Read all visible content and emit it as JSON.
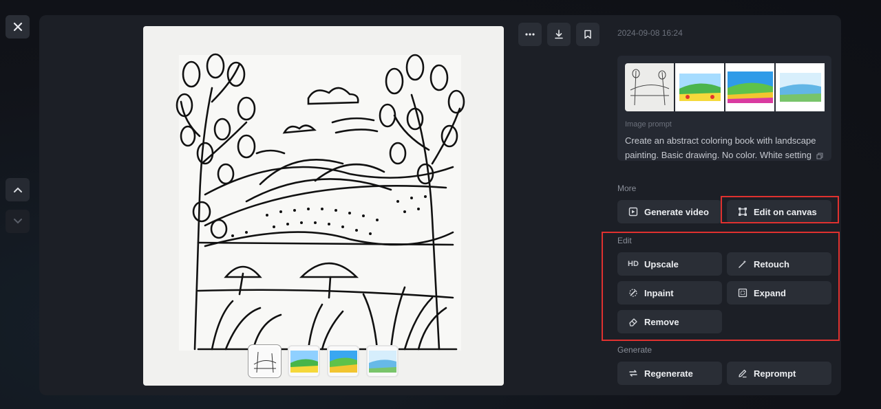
{
  "timestamp": "2024-09-08 16:24",
  "prompt": {
    "label": "Image prompt",
    "text": "Create an abstract coloring book with landscape painting. Basic drawing. No color. White setting"
  },
  "sections": {
    "more": {
      "label": "More",
      "items": [
        {
          "label": "Generate video",
          "icon": "video-plus-icon"
        },
        {
          "label": "Edit on canvas",
          "icon": "canvas-frame-icon"
        }
      ]
    },
    "edit": {
      "label": "Edit",
      "items": [
        {
          "label": "Upscale",
          "icon": "hd-icon",
          "glyph": "HD"
        },
        {
          "label": "Retouch",
          "icon": "magic-wand-icon"
        },
        {
          "label": "Inpaint",
          "icon": "inpaint-brush-icon"
        },
        {
          "label": "Expand",
          "icon": "expand-frame-icon"
        },
        {
          "label": "Remove",
          "icon": "eraser-icon"
        }
      ]
    },
    "generate": {
      "label": "Generate",
      "items": [
        {
          "label": "Regenerate",
          "icon": "regenerate-icon"
        },
        {
          "label": "Reprompt",
          "icon": "pencil-icon"
        }
      ]
    }
  },
  "toolbar": {
    "more_icon": "more-dots-icon",
    "download_icon": "download-icon",
    "bookmark_icon": "bookmark-icon"
  },
  "colors": {
    "highlight": "#e0312f",
    "panel": "#1c1f26",
    "button": "#2a2e36"
  }
}
